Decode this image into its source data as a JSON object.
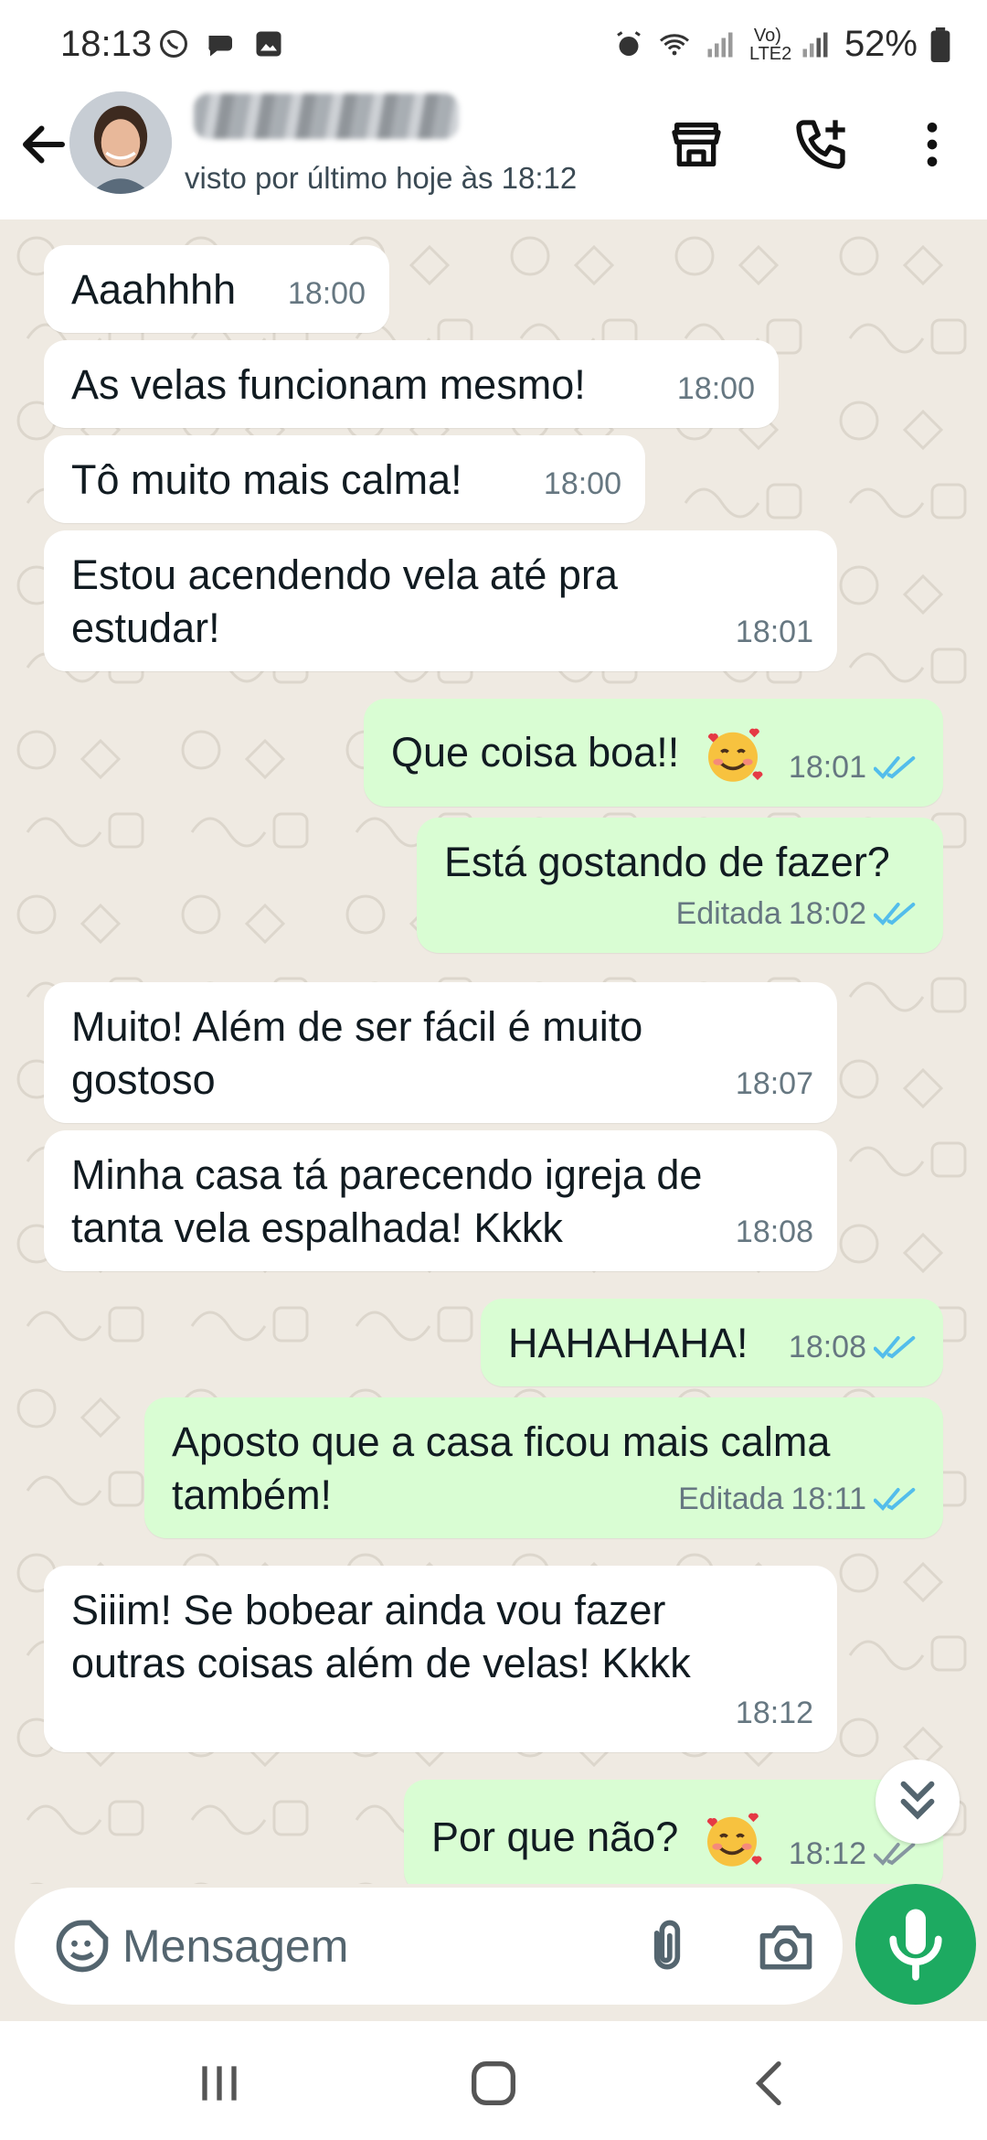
{
  "status_bar": {
    "time": "18:13",
    "battery": "52%",
    "network_label": "Vo) LTE2"
  },
  "header": {
    "last_seen": "visto por último hoje às 18:12"
  },
  "messages": [
    {
      "dir": "in",
      "text": "Aaahhhh",
      "time": "18:00"
    },
    {
      "dir": "in",
      "text": "As velas funcionam mesmo!",
      "time": "18:00"
    },
    {
      "dir": "in",
      "text": "Tô muito mais calma!",
      "time": "18:00"
    },
    {
      "dir": "in",
      "text": "Estou acendendo vela até pra estudar!",
      "time": "18:01"
    },
    {
      "dir": "out",
      "text": "Que coisa boa!!",
      "emoji": "smiling-face-with-hearts",
      "time": "18:01",
      "status": "read"
    },
    {
      "dir": "out",
      "text": "Está gostando de fazer?",
      "edited": "Editada",
      "time": "18:02",
      "status": "read"
    },
    {
      "dir": "in",
      "text": "Muito! Além de ser fácil é muito gostoso",
      "time": "18:07"
    },
    {
      "dir": "in",
      "text": "Minha casa tá parecendo igreja de tanta vela espalhada! Kkkk",
      "time": "18:08"
    },
    {
      "dir": "out",
      "text": "HAHAHAHA!",
      "time": "18:08",
      "status": "read"
    },
    {
      "dir": "out",
      "text": "Aposto que a casa ficou mais calma também!",
      "edited": "Editada",
      "time": "18:11",
      "status": "read"
    },
    {
      "dir": "in",
      "text": "Siiim! Se bobear ainda vou fazer outras coisas além de velas! Kkkk",
      "time": "18:12"
    },
    {
      "dir": "out",
      "text": "Por que não?",
      "emoji": "smiling-face-with-hearts",
      "time": "18:12",
      "status": "delivered"
    }
  ],
  "composer": {
    "placeholder": "Mensagem"
  },
  "colors": {
    "chat_bg": "#efeae2",
    "incoming_bubble": "#ffffff",
    "outgoing_bubble": "#d9fdd3",
    "read_tick": "#53bdeb",
    "delivered_tick": "#8696a0",
    "accent_green": "#1daa61"
  }
}
